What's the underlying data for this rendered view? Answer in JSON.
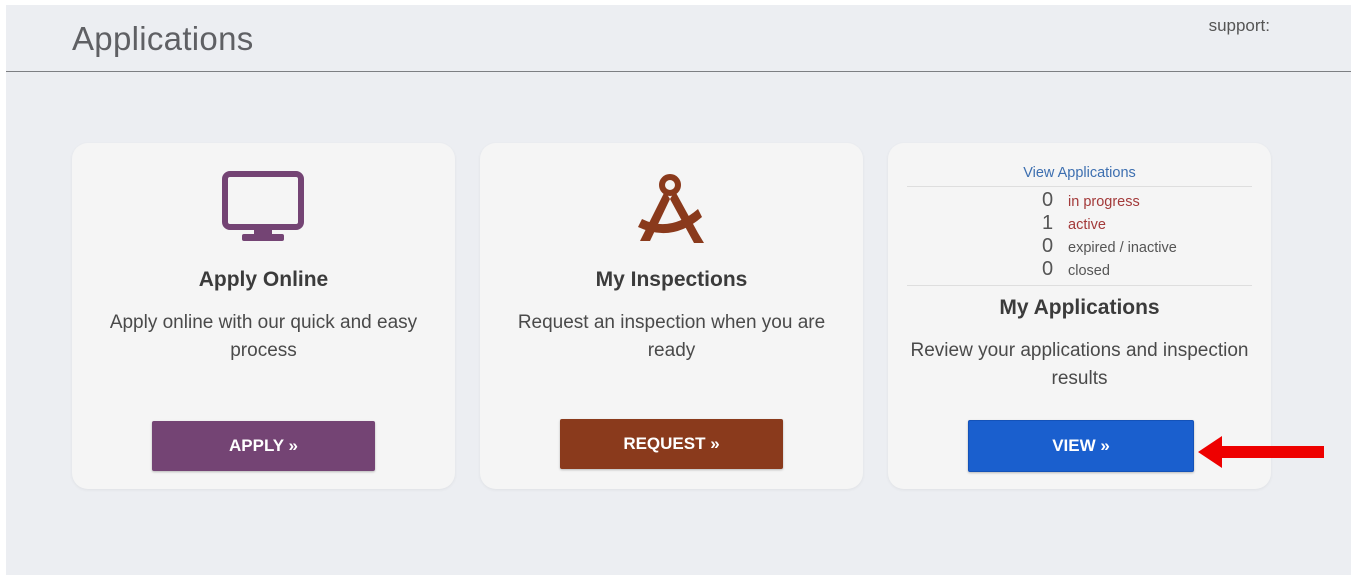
{
  "header": {
    "title": "Applications",
    "support_label": "support:"
  },
  "cards": {
    "apply": {
      "icon": "monitor-icon",
      "title": "Apply Online",
      "description": "Apply online with our quick and easy process",
      "button_label": "APPLY »",
      "button_color": "#744474",
      "icon_color": "#744474"
    },
    "inspections": {
      "icon": "compass-icon",
      "title": "My Inspections",
      "description": "Request an inspection when you are ready",
      "button_label": "REQUEST »",
      "button_color": "#8a3a1c",
      "icon_color": "#8a3a1c"
    },
    "applications": {
      "view_link": "View Applications",
      "stats": [
        {
          "count": "0",
          "label": "in progress",
          "color": "#a33a3a"
        },
        {
          "count": "1",
          "label": "active",
          "color": "#a33a3a"
        },
        {
          "count": "0",
          "label": "expired / inactive",
          "color": "#555555"
        },
        {
          "count": "0",
          "label": "closed",
          "color": "#555555"
        }
      ],
      "title": "My Applications",
      "description": "Review your applications and inspection results",
      "button_label": "VIEW »",
      "button_color": "#1a5fce"
    }
  },
  "annotation": {
    "arrow_icon": "red-arrow-left-icon",
    "arrow_color": "#ee0000"
  }
}
